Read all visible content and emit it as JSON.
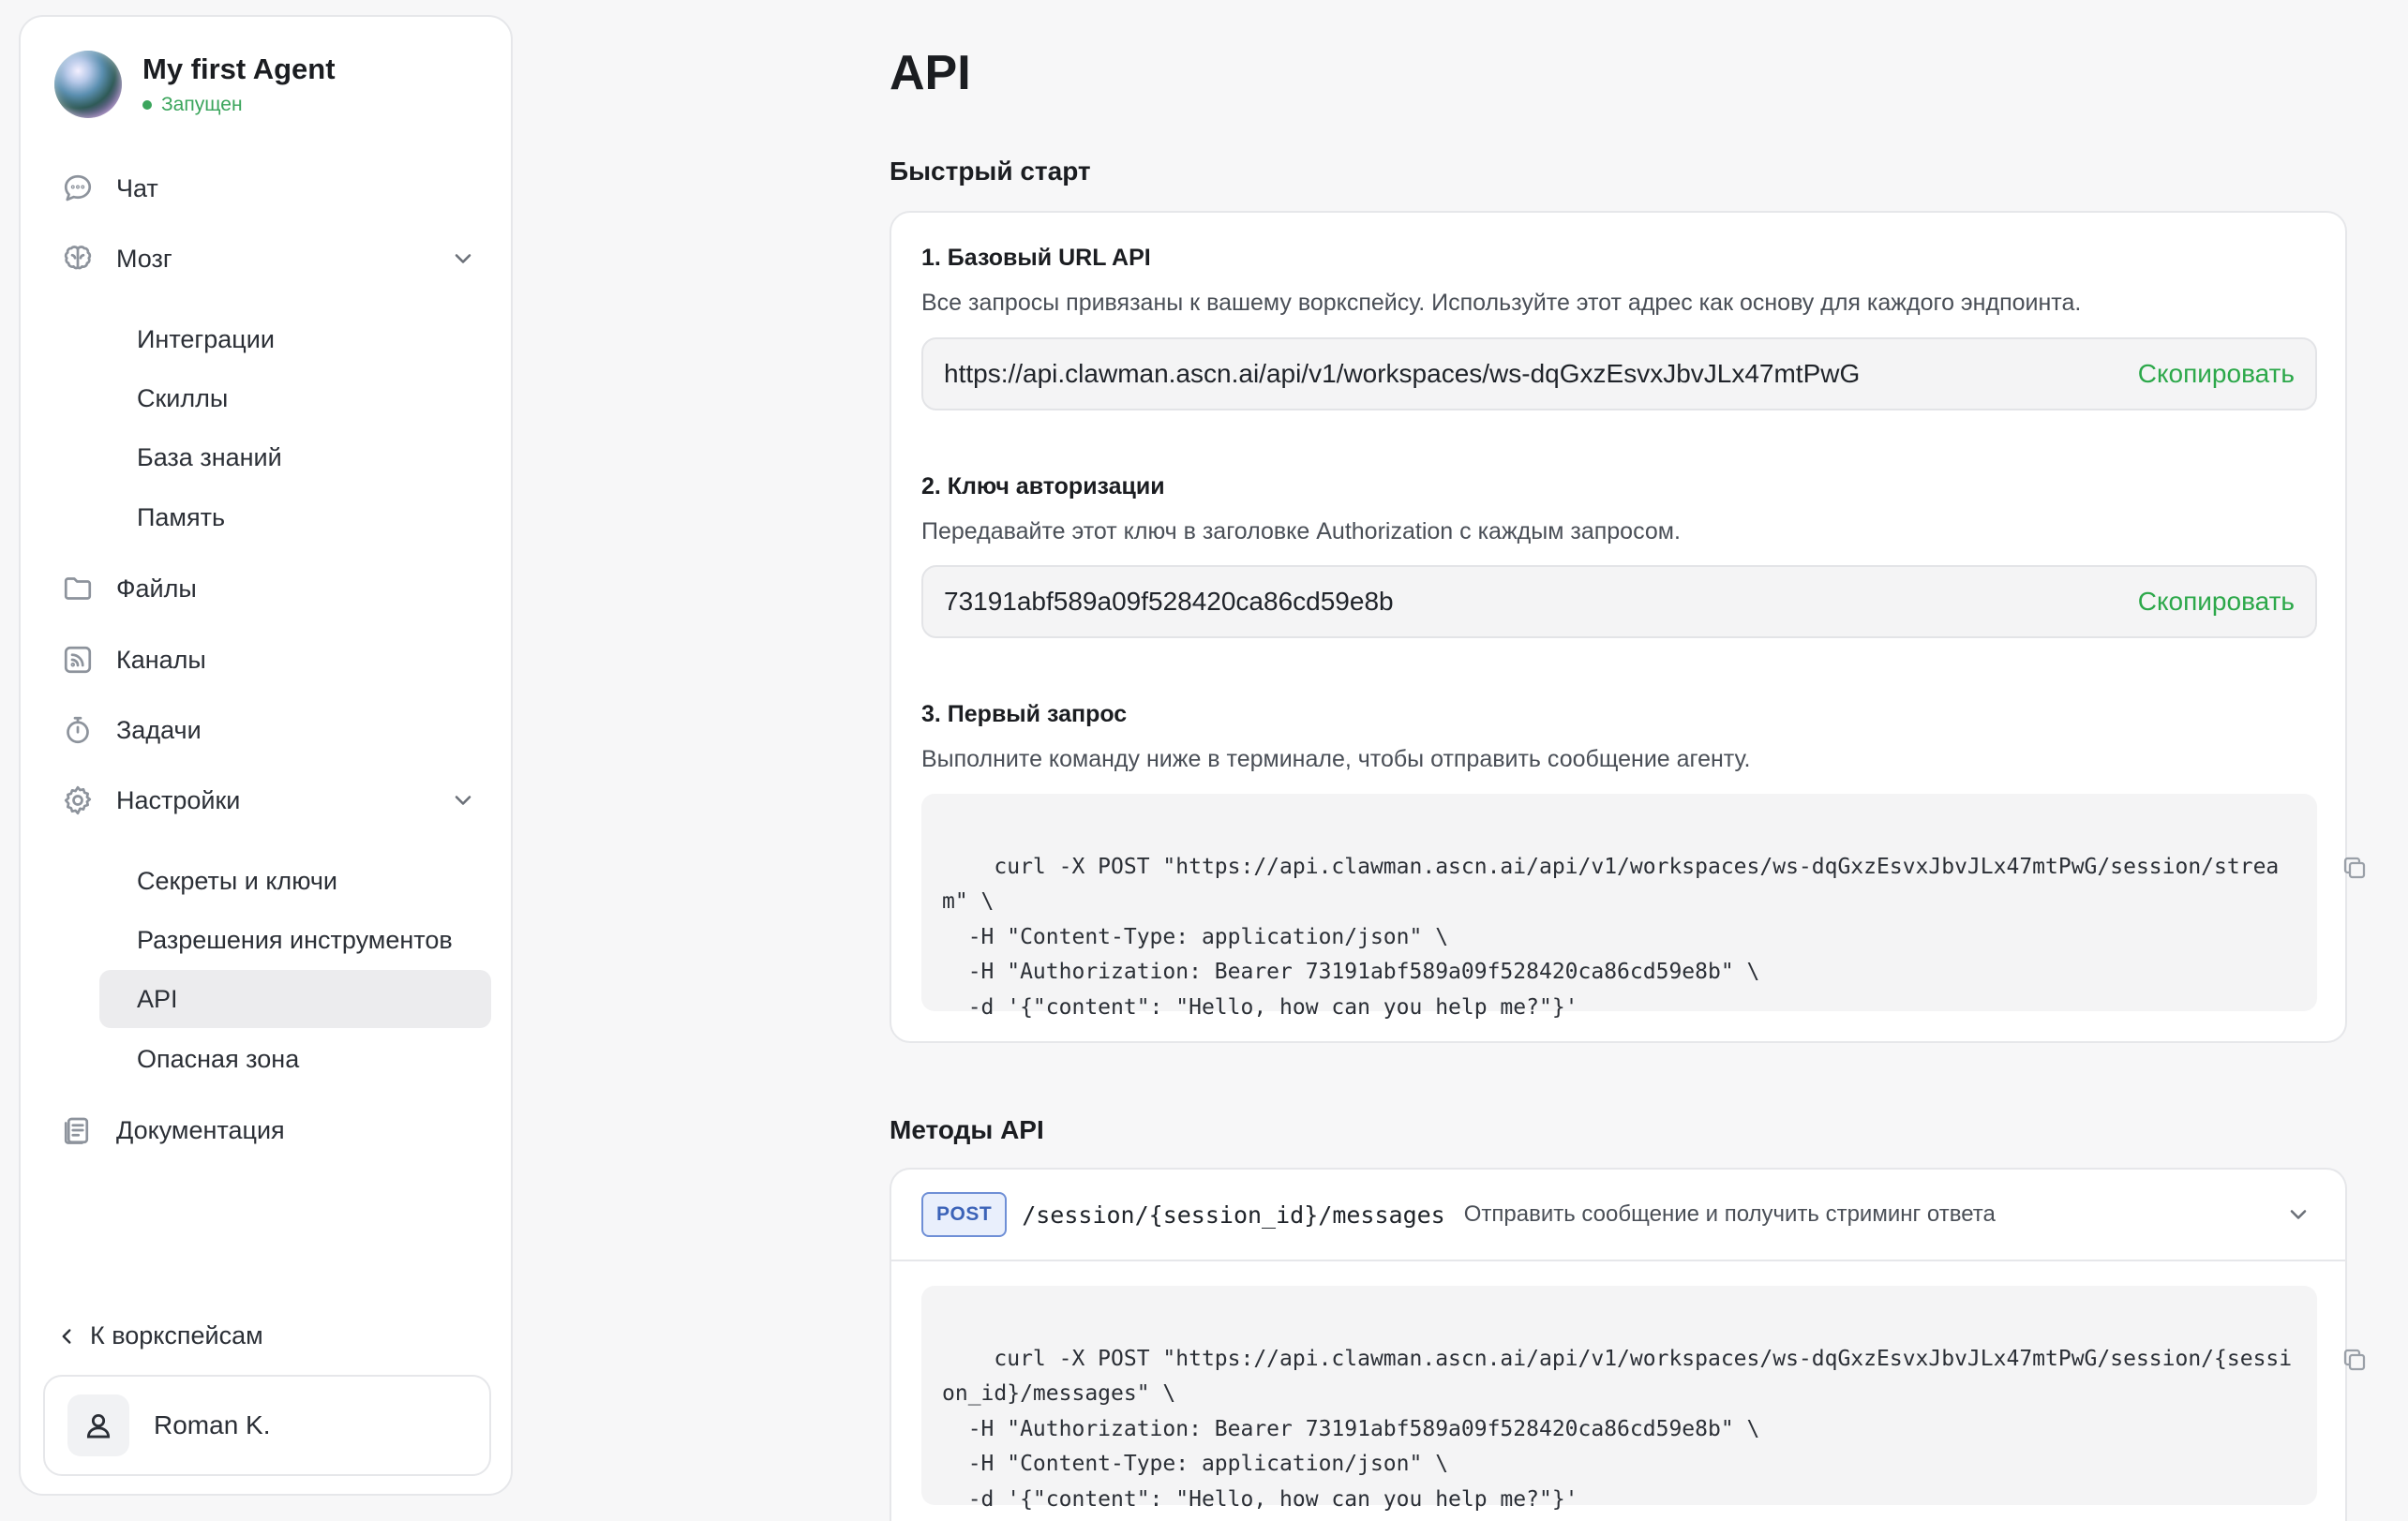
{
  "agent": {
    "name": "My first Agent",
    "status": "Запущен"
  },
  "sidebar": {
    "nav": {
      "chat": "Чат",
      "brain": "Мозг",
      "files": "Файлы",
      "channels": "Каналы",
      "tasks": "Задачи",
      "settings": "Настройки",
      "docs": "Документация"
    },
    "brain_sub": [
      "Интеграции",
      "Скиллы",
      "База знаний",
      "Память"
    ],
    "settings_sub": [
      "Секреты и ключи",
      "Разрешения инструментов",
      "API",
      "Опасная зона"
    ],
    "active_item": "API",
    "back_label": "К воркспейсам",
    "user_name": "Roman K."
  },
  "page": {
    "title": "API",
    "quickstart": {
      "heading": "Быстрый старт",
      "step1": {
        "title": "1. Базовый URL API",
        "desc": "Все запросы привязаны к вашему воркспейсу. Используйте этот адрес как основу для каждого эндпоинта.",
        "value": "https://api.clawman.ascn.ai/api/v1/workspaces/ws-dqGxzEsvxJbvJLx47mtPwG",
        "copy_label": "Скопировать"
      },
      "step2": {
        "title": "2. Ключ авторизации",
        "desc": "Передавайте этот ключ в заголовке Authorization с каждым запросом.",
        "value": "73191abf589a09f528420ca86cd59e8b",
        "copy_label": "Скопировать"
      },
      "step3": {
        "title": "3. Первый запрос",
        "desc": "Выполните команду ниже в терминале, чтобы отправить сообщение агенту.",
        "code": "curl -X POST \"https://api.clawman.ascn.ai/api/v1/workspaces/ws-dqGxzEsvxJbvJLx47mtPwG/session/strea\nm\" \\\n  -H \"Content-Type: application/json\" \\\n  -H \"Authorization: Bearer 73191abf589a09f528420ca86cd59e8b\" \\\n  -d '{\"content\": \"Hello, how can you help me?\"}'"
      }
    },
    "methods": {
      "heading": "Методы API",
      "items": [
        {
          "method": "POST",
          "path": "/session/{session_id}/messages",
          "desc": "Отправить сообщение и получить стриминг ответа",
          "code": "curl -X POST \"https://api.clawman.ascn.ai/api/v1/workspaces/ws-dqGxzEsvxJbvJLx47mtPwG/session/{sessi\non_id}/messages\" \\\n  -H \"Authorization: Bearer 73191abf589a09f528420ca86cd59e8b\" \\\n  -H \"Content-Type: application/json\" \\\n  -d '{\"content\": \"Hello, how can you help me?\"}'"
        }
      ]
    }
  },
  "icons": {
    "chat": "chat-bubble-icon",
    "brain": "brain-icon",
    "files": "folder-icon",
    "channels": "rss-icon",
    "tasks": "timer-icon",
    "settings": "gear-icon",
    "docs": "document-icon",
    "copy": "copy-icon",
    "user": "user-icon"
  },
  "colors": {
    "accent_green": "#2ca84a",
    "status_green": "#3ba55c",
    "badge_blue": "#3c63b8",
    "active_bg": "#ececee"
  }
}
